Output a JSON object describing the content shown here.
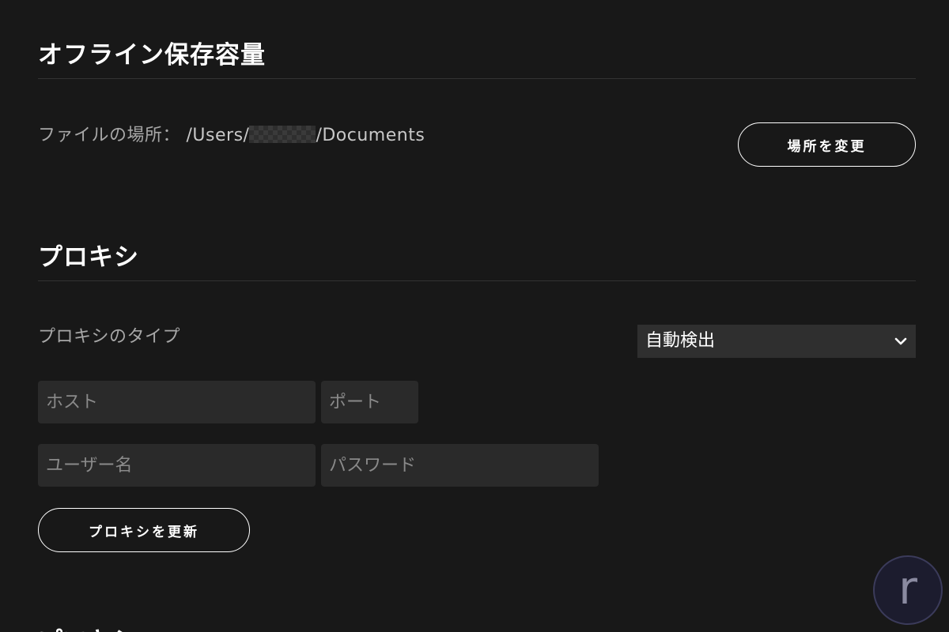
{
  "offline": {
    "title": "オフライン保存容量",
    "location_label": "ファイルの場所：",
    "path_prefix": "/Users/",
    "path_suffix": "/Documents",
    "change_button": "場所を変更"
  },
  "proxy": {
    "title": "プロキシ",
    "type_label": "プロキシのタイプ",
    "type_selected": "自動検出",
    "host_placeholder": "ホスト",
    "port_placeholder": "ポート",
    "username_placeholder": "ユーザー名",
    "password_placeholder": "パスワード",
    "update_button": "プロキシを更新"
  },
  "next_section": {
    "title": "プロキシ"
  },
  "logo": {
    "letter": "r"
  },
  "colors": {
    "background": "#181818",
    "field_background": "#2a2a2a",
    "select_background": "#2f2f2f",
    "label_gray": "#a7a7a7",
    "divider": "#333333"
  }
}
